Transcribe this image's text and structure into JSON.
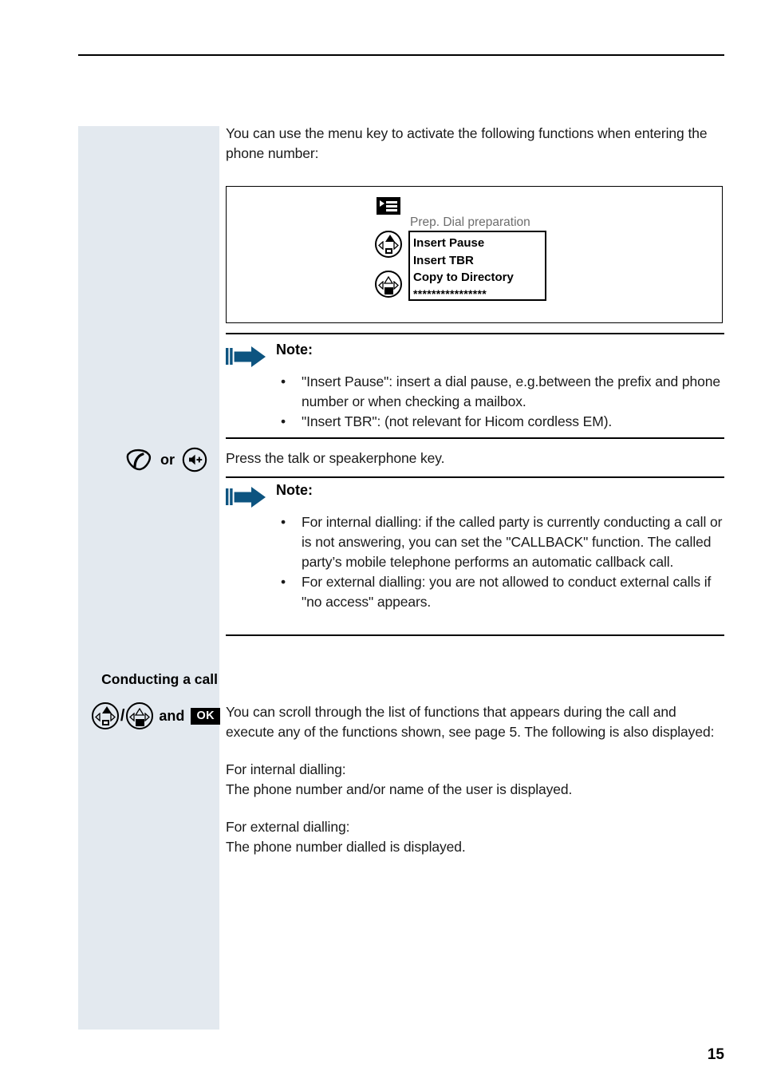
{
  "page": {
    "number": "15"
  },
  "intro": {
    "paragraph": "You can use the menu key to activate the following functions when entering the phone number:"
  },
  "display_illustration": {
    "menu_key_icon": "menu-key-icon",
    "caption": "Prep. Dial preparation",
    "list_items": [
      "Insert Pause",
      "Insert TBR",
      "Copy to Directory"
    ],
    "masked_line": "****************",
    "nav_icon_up": "navigation-key-up-icon",
    "nav_icon_down": "navigation-key-down-icon"
  },
  "note_one": {
    "title": "Note:",
    "bullets": [
      "\"Insert Pause\": insert a dial pause, e.g.between the prefix and phone number or when checking a mailbox.",
      "\"Insert TBR\": (not relevant for Hicom cordless EM)."
    ],
    "bullet_glyph": "•"
  },
  "press_key_row": {
    "talk_icon": "talk-key-icon",
    "or_label": "or",
    "speakerphone_icon": "speakerphone-key-icon",
    "instruction": "Press the talk or speakerphone key."
  },
  "note_two": {
    "title": "Note:",
    "bullets": [
      "For internal dialling: if the called party is currently conducting a call or is not answering, you can set the \"CALLBACK\" function. The called party’s mobile telephone performs an automatic callback call.",
      "For external dialling: you are not allowed to conduct external calls if \"no access\" appears."
    ],
    "bullet_glyph": "•"
  },
  "conducting_a_call": {
    "heading": "Conducting a call",
    "nav_icon_up": "navigation-key-up-icon",
    "separator": "/",
    "nav_icon_down": "navigation-key-down-icon",
    "and_label": "and",
    "ok_key_label": "OK",
    "paragraphs": [
      "You can scroll through the list of functions that appears during the call and execute any of the functions shown, see page 5. The following is also displayed:",
      "For internal dialling:\nThe phone number and/or name of the user is displayed.",
      "For external dialling:\nThe phone number dialled is displayed."
    ],
    "internal_heading": "For internal dialling:",
    "internal_text": "The phone number and/or name of the user is displayed.",
    "external_heading": "For external dialling:",
    "external_text": "The phone number dialled is displayed."
  },
  "colors": {
    "sidebar_background": "#e3e9ef",
    "note_arrow": "#0d5480",
    "caption_gray": "#6d6d6d",
    "body_text": "#1a1a1a"
  }
}
